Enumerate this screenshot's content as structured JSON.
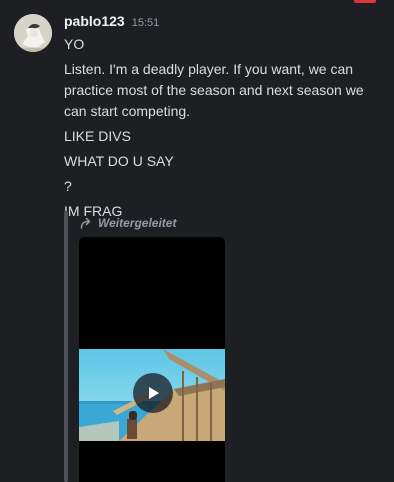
{
  "message": {
    "username": "pablo123",
    "timestamp": "15:51",
    "lines": [
      "YO",
      "Listen. I'm a deadly player. If you want, we can practice most of the season and next season we can start competing.",
      "LIKE DIVS",
      "WHAT DO U SAY",
      "?",
      "IM FRAG"
    ],
    "forwarded_label": "Weitergeleitet"
  },
  "icons": {
    "avatar": "avatar",
    "forward": "forward-arrow-icon",
    "play": "play-icon"
  },
  "colors": {
    "background": "#1e1f22",
    "username": "#f2f3f5",
    "text": "#dbdee1",
    "muted": "#949ba4",
    "forward_bar": "#4e5058"
  }
}
